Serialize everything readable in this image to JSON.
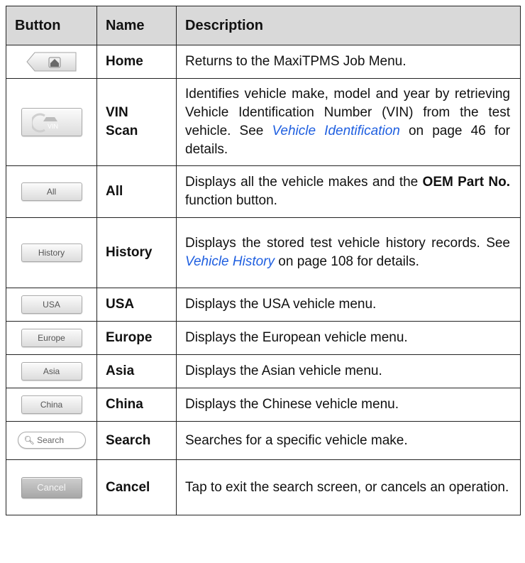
{
  "headers": {
    "button": "Button",
    "name": "Name",
    "description": "Description"
  },
  "rows": {
    "home": {
      "name": "Home",
      "desc": "Returns to the MaxiTPMS Job Menu."
    },
    "vin": {
      "name_line1": "VIN",
      "name_line2": "Scan",
      "desc_pre": "Identifies vehicle make, model and year by retrieving Vehicle Identification Number (VIN) from the test vehicle. See ",
      "desc_link": "Vehicle Identification",
      "desc_post": " on page 46 for details.",
      "icon_text": "VIN"
    },
    "all": {
      "btn_label": "All",
      "name": "All",
      "desc_pre": "Displays all the vehicle makes and the ",
      "desc_bold": "OEM Part No.",
      "desc_post": " function button."
    },
    "history": {
      "btn_label": "History",
      "name": "History",
      "desc_pre": "Displays the stored test vehicle history records. See ",
      "desc_link": "Vehicle History",
      "desc_post": " on page 108 for details."
    },
    "usa": {
      "btn_label": "USA",
      "name": "USA",
      "desc": "Displays the USA vehicle menu."
    },
    "europe": {
      "btn_label": "Europe",
      "name": "Europe",
      "desc": "Displays the European vehicle menu."
    },
    "asia": {
      "btn_label": "Asia",
      "name": "Asia",
      "desc": "Displays the Asian vehicle menu."
    },
    "china": {
      "btn_label": "China",
      "name": "China",
      "desc": "Displays the Chinese vehicle menu."
    },
    "search": {
      "btn_label": "Search",
      "name": "Search",
      "desc": "Searches for a specific vehicle make."
    },
    "cancel": {
      "btn_label": "Cancel",
      "name": "Cancel",
      "desc": "Tap to exit the search screen, or cancels an operation."
    }
  },
  "colors": {
    "link": "#1f5fe0",
    "header_bg": "#d9d9d9"
  }
}
